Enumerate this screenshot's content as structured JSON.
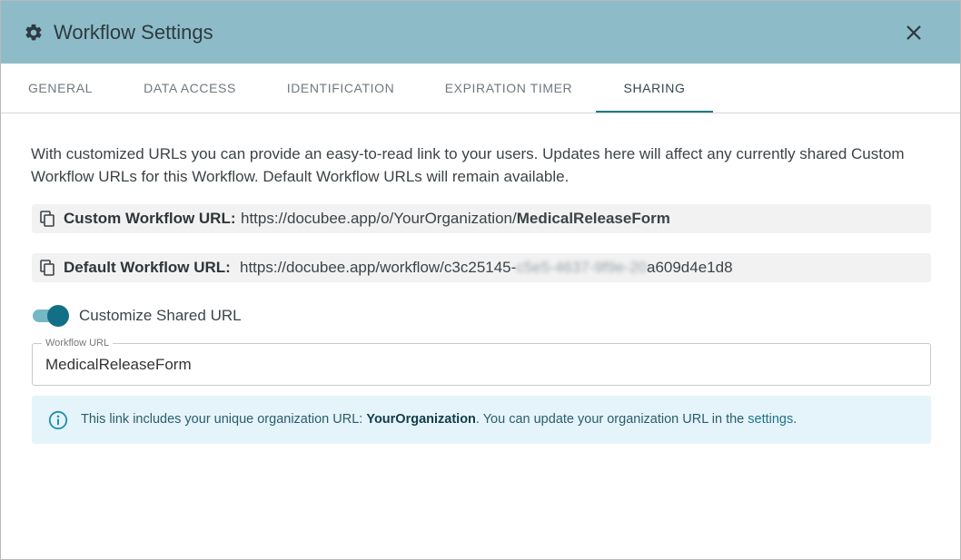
{
  "dialog": {
    "title": "Workflow Settings",
    "icon": "gear-icon",
    "close_icon": "close-icon"
  },
  "tabs": [
    {
      "label": "GENERAL",
      "active": false
    },
    {
      "label": "DATA ACCESS",
      "active": false
    },
    {
      "label": "IDENTIFICATION",
      "active": false
    },
    {
      "label": "EXPIRATION TIMER",
      "active": false
    },
    {
      "label": "SHARING",
      "active": true
    }
  ],
  "sharing": {
    "description": "With customized URLs you can provide an easy-to-read link to your users. Updates here will affect any currently shared Custom Workflow URLs for this Workflow. Default Workflow URLs will remain available.",
    "custom_url": {
      "label": "Custom Workflow URL:",
      "prefix": "https://docubee.app/o/YourOrganization/",
      "slug": "MedicalReleaseForm"
    },
    "default_url": {
      "label": "Default Workflow URL:",
      "prefix": "https://docubee.app/workflow/c3c25145-",
      "blurred": "c5e5-4637-9f9e-20",
      "suffix": "a609d4e1d8"
    },
    "toggle": {
      "label": "Customize Shared URL",
      "on": true
    },
    "workflow_url_field": {
      "label": "Workflow URL",
      "value": "MedicalReleaseForm"
    },
    "info": {
      "text_before": "This link includes your unique organization URL: ",
      "org": "YourOrganization",
      "text_middle": ". You can update your organization URL in the ",
      "link": "settings",
      "text_after": "."
    }
  },
  "colors": {
    "header_bg": "#8dbcc8",
    "accent": "#136f86",
    "info_bg": "#e4f4fa"
  }
}
